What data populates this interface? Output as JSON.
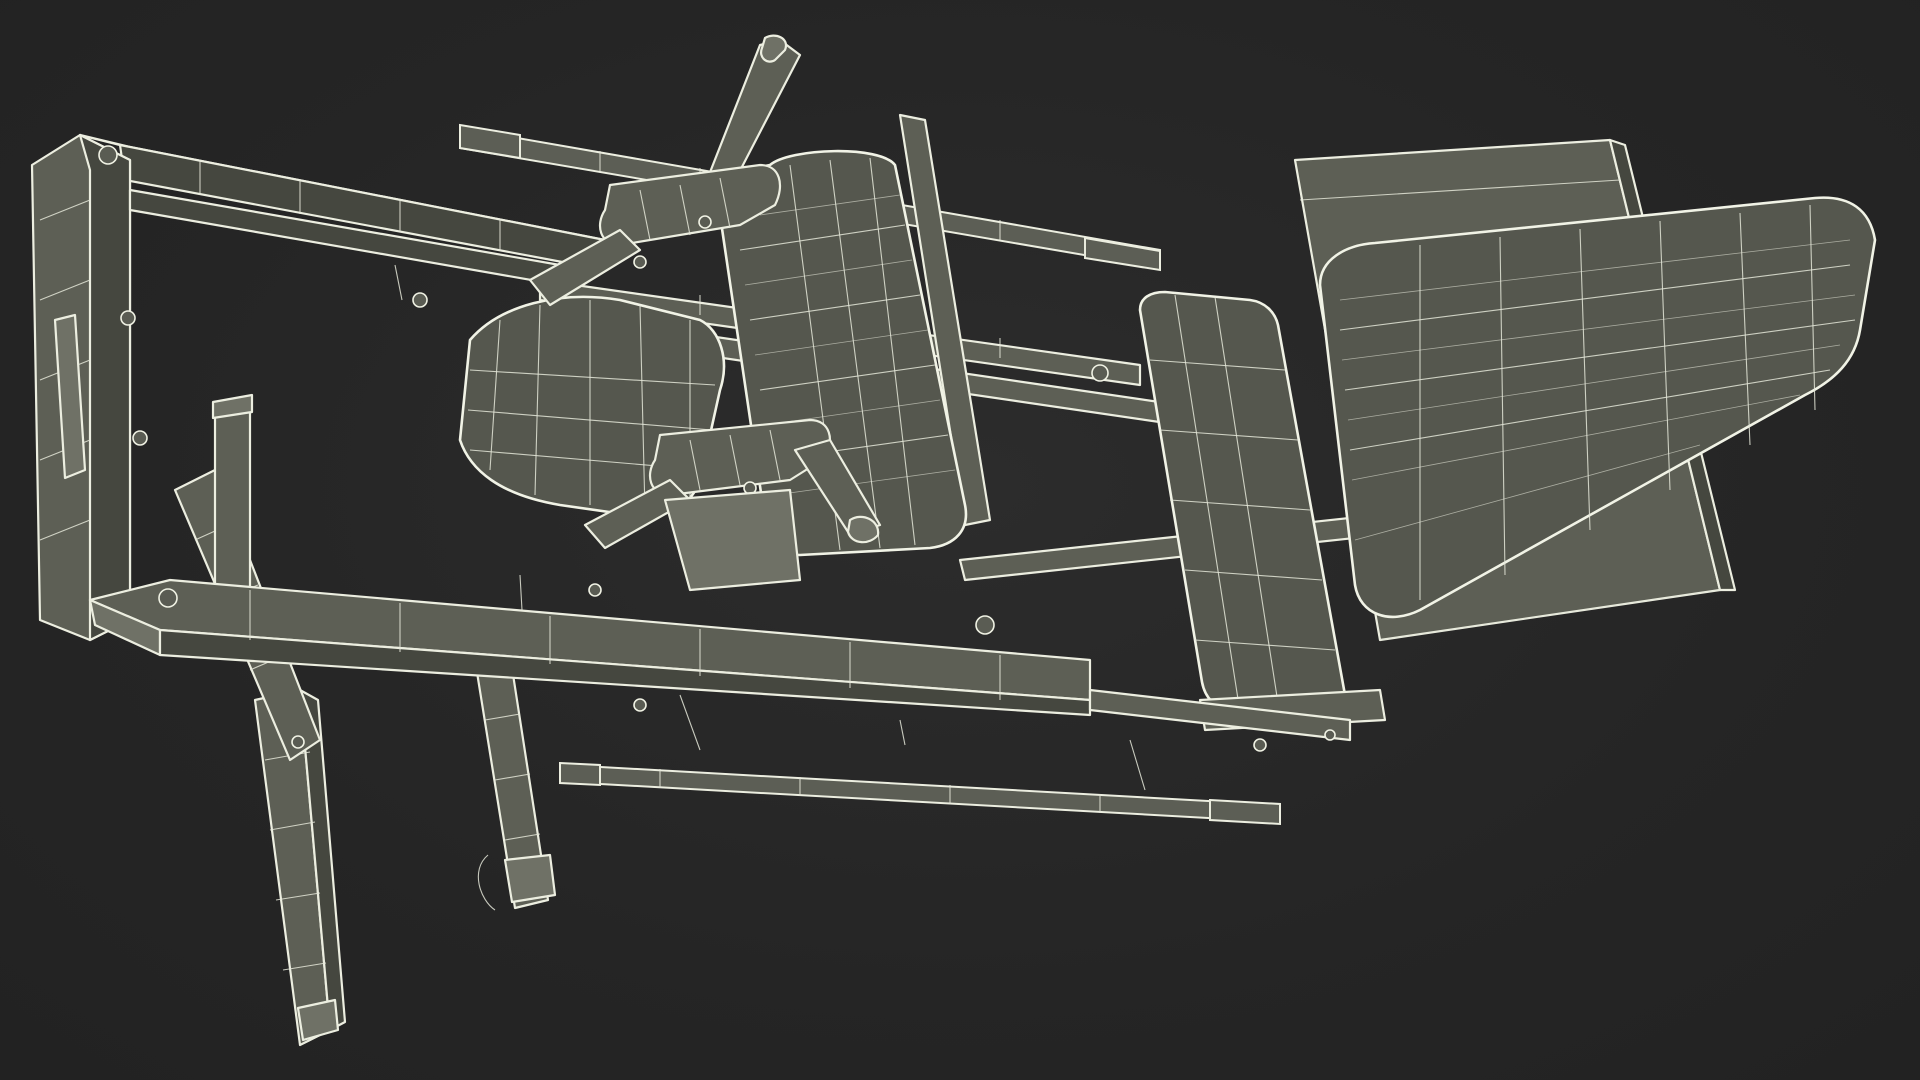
{
  "scene": {
    "subject": "leg-press-machine-wireframe",
    "background_color": "#262626",
    "mesh_color": "#5d5f55",
    "wire_color": "#eceee0"
  }
}
